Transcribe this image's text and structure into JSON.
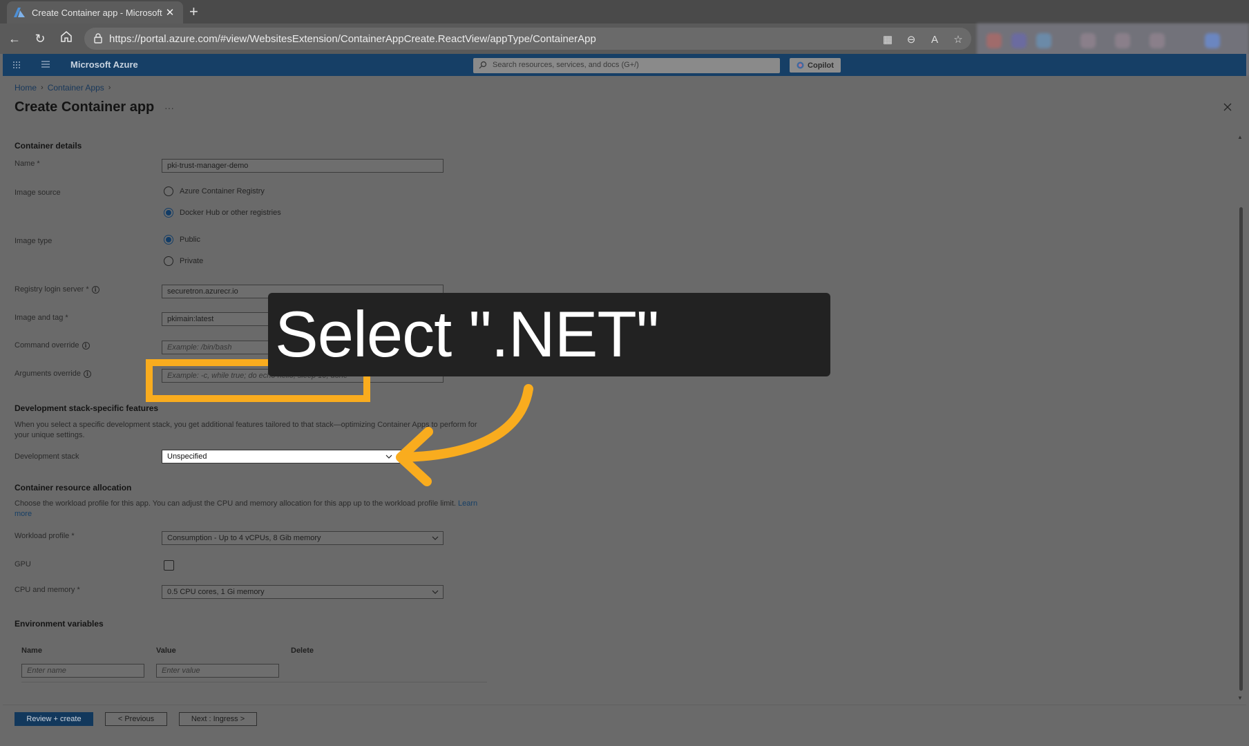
{
  "browser": {
    "tab_title": "Create Container app - Microsoft",
    "url": "https://portal.azure.com/#view/WebsitesExtension/ContainerAppCreate.ReactView/appType/ContainerApp"
  },
  "azure_header": {
    "brand": "Microsoft Azure",
    "search_placeholder": "Search resources, services, and docs (G+/)",
    "copilot_label": "Copilot"
  },
  "breadcrumb": {
    "items": [
      "Home",
      "Container Apps"
    ]
  },
  "page_title": "Create Container app",
  "more_label": "···",
  "container_details": {
    "heading": "Container details",
    "name_label": "Name *",
    "name_value": "pki-trust-manager-demo",
    "image_source_label": "Image source",
    "image_source_options": [
      "Azure Container Registry",
      "Docker Hub or other registries"
    ],
    "image_source_selected": 1,
    "image_type_label": "Image type",
    "image_type_options": [
      "Public",
      "Private"
    ],
    "image_type_selected": 0,
    "registry_label": "Registry login server *",
    "registry_value": "securetron.azurecr.io",
    "image_tag_label": "Image and tag *",
    "image_tag_value": "pkimain:latest",
    "command_label": "Command override",
    "command_placeholder": "Example: /bin/bash",
    "args_label": "Arguments override",
    "args_placeholder": "Example: -c, while true; do echo hello; sleep 10; done"
  },
  "dev_stack": {
    "heading": "Development stack-specific features",
    "description": "When you select a specific development stack, you get additional features tailored to that stack—optimizing Container Apps to perform for your unique settings.",
    "label": "Development stack",
    "value": "Unspecified"
  },
  "resources": {
    "heading": "Container resource allocation",
    "description": "Choose the workload profile for this app. You can adjust the CPU and memory allocation for this app up to the workload profile limit.",
    "learn_more": "Learn more",
    "workload_label": "Workload profile *",
    "workload_value": "Consumption - Up to 4 vCPUs, 8 Gib memory",
    "gpu_label": "GPU",
    "cpu_label": "CPU and memory *",
    "cpu_value": "0.5 CPU cores, 1 Gi memory"
  },
  "env": {
    "heading": "Environment variables",
    "columns": [
      "Name",
      "Value",
      "Delete"
    ],
    "name_placeholder": "Enter name",
    "value_placeholder": "Enter value"
  },
  "footer": {
    "review_create": "Review + create",
    "previous": "< Previous",
    "next": "Next : Ingress >"
  },
  "callout": {
    "text": "Select \".NET\""
  },
  "colors": {
    "azure_header": "#163f66",
    "highlight": "#f9ac1e",
    "callout_bg": "#222222",
    "primary_button": "#12385c"
  }
}
